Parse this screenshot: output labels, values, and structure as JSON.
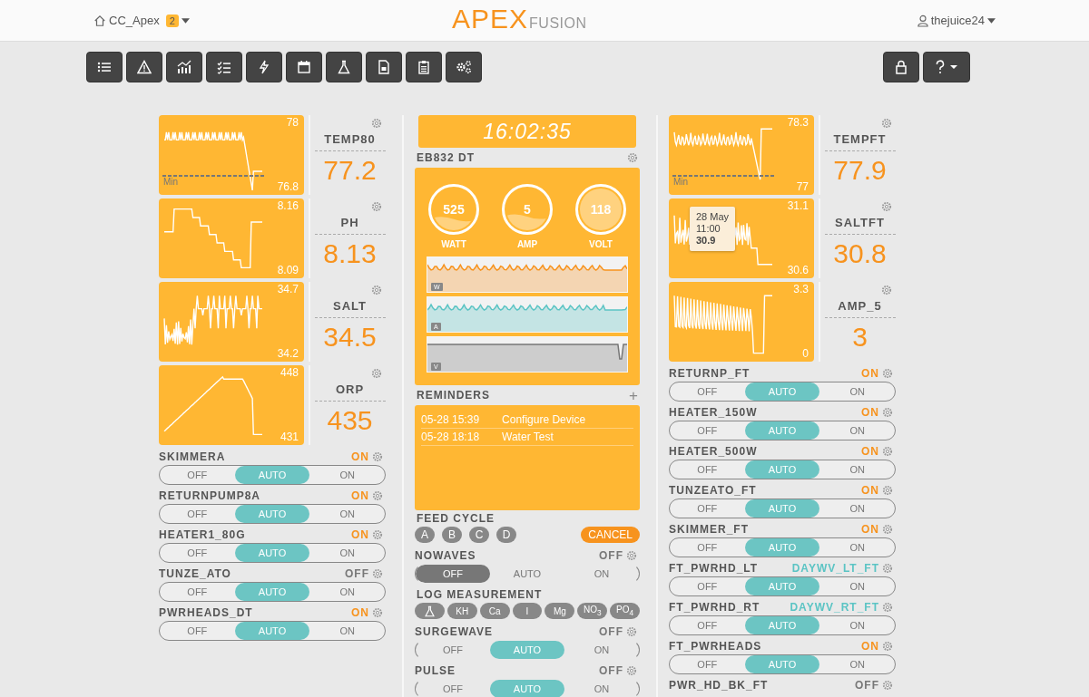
{
  "header": {
    "site": "CC_Apex",
    "badge": "2",
    "logo_main": "APEX",
    "logo_sub": "FUSION",
    "user": "thejuice24"
  },
  "left_sensors": [
    {
      "name": "TEMP80",
      "max": "78",
      "min": "76.8",
      "min_label": "Min",
      "value": "77.2"
    },
    {
      "name": "PH",
      "max": "8.16",
      "min": "8.09",
      "value": "8.13"
    },
    {
      "name": "SALT",
      "max": "34.7",
      "min": "34.2",
      "value": "34.5"
    },
    {
      "name": "ORP",
      "max": "448",
      "min": "431",
      "value": "435"
    }
  ],
  "left_outlets": [
    {
      "name": "SKIMMERA",
      "status": "ON",
      "color": "#f7931e",
      "options": [
        {
          "label": "OFF",
          "selected": false
        },
        {
          "label": "AUTO",
          "selected": true
        },
        {
          "label": "ON",
          "selected": false
        }
      ]
    },
    {
      "name": "RETURNPUMP8A",
      "status": "ON",
      "color": "#f7931e",
      "options": [
        {
          "label": "OFF",
          "selected": false
        },
        {
          "label": "AUTO",
          "selected": true
        },
        {
          "label": "ON",
          "selected": false
        }
      ]
    },
    {
      "name": "HEATER1_80G",
      "status": "ON",
      "color": "#f7931e",
      "options": [
        {
          "label": "OFF",
          "selected": false
        },
        {
          "label": "AUTO",
          "selected": true
        },
        {
          "label": "ON",
          "selected": false
        }
      ]
    },
    {
      "name": "TUNZE_ATO",
      "status": "OFF",
      "color": "#777777",
      "options": [
        {
          "label": "OFF",
          "selected": false
        },
        {
          "label": "AUTO",
          "selected": true
        },
        {
          "label": "ON",
          "selected": false
        }
      ]
    },
    {
      "name": "PWRHEADS_DT",
      "status": "ON",
      "color": "#f7931e",
      "options": [
        {
          "label": "OFF",
          "selected": false
        },
        {
          "label": "AUTO",
          "selected": true
        },
        {
          "label": "ON",
          "selected": false
        }
      ]
    }
  ],
  "clock": "16:02:35",
  "power": {
    "title": "EB832 DT",
    "gauges": [
      {
        "value": "525",
        "label": "WATT"
      },
      {
        "value": "5",
        "label": "AMP"
      },
      {
        "value": "118",
        "label": "VOLT"
      }
    ],
    "traces": [
      {
        "label": "W",
        "color": "#f7931e"
      },
      {
        "label": "A",
        "color": "#5bc4c4"
      },
      {
        "label": "V",
        "color": "#777777"
      }
    ]
  },
  "reminders": {
    "title": "REMINDERS",
    "add": "+",
    "items": [
      {
        "time": "05-28 15:39",
        "text": "Configure Device"
      },
      {
        "time": "05-28 18:18",
        "text": "Water Test"
      }
    ]
  },
  "feed_cycle": {
    "title": "FEED CYCLE",
    "buttons": [
      "A",
      "B",
      "C",
      "D"
    ],
    "cancel": "CANCEL"
  },
  "programs_top": [
    {
      "name": "NOWAVES",
      "status": "OFF",
      "options": [
        {
          "label": "OFF",
          "selected": true
        },
        {
          "label": "AUTO",
          "selected": false
        },
        {
          "label": "ON",
          "selected": false
        }
      ]
    }
  ],
  "log_measurement": {
    "title": "LOG MEASUREMENT",
    "buttons": [
      "KH",
      "Ca",
      "I",
      "Mg",
      "NO$_{3}$",
      "PO$_{4}$"
    ]
  },
  "programs_bottom": [
    {
      "name": "SURGEWAVE",
      "status": "OFF",
      "options": [
        {
          "label": "OFF",
          "selected": false
        },
        {
          "label": "AUTO",
          "selected": true
        },
        {
          "label": "ON",
          "selected": false
        }
      ]
    },
    {
      "name": "PULSE",
      "status": "OFF",
      "options": [
        {
          "label": "OFF",
          "selected": false
        },
        {
          "label": "AUTO",
          "selected": true
        },
        {
          "label": "ON",
          "selected": false
        }
      ]
    }
  ],
  "right_sensors": [
    {
      "name": "TEMPFT",
      "max": "78.3",
      "min": "77",
      "min_label": "Min",
      "value": "77.9"
    },
    {
      "name": "SALTFT",
      "max": "31.1",
      "min": "30.6",
      "value": "30.8",
      "tooltip": {
        "date": "28 May",
        "time": "11:00",
        "value": "30.9"
      }
    },
    {
      "name": "AMP_5",
      "max": "3.3",
      "min": "0",
      "value": "3"
    }
  ],
  "right_outlets": [
    {
      "name": "RETURNP_FT",
      "status": "ON",
      "color": "#f7931e",
      "options": [
        {
          "label": "OFF",
          "selected": false
        },
        {
          "label": "AUTO",
          "selected": true
        },
        {
          "label": "ON",
          "selected": false
        }
      ]
    },
    {
      "name": "HEATER_150W",
      "status": "ON",
      "color": "#f7931e",
      "options": [
        {
          "label": "OFF",
          "selected": false
        },
        {
          "label": "AUTO",
          "selected": true
        },
        {
          "label": "ON",
          "selected": false
        }
      ]
    },
    {
      "name": "HEATER_500W",
      "status": "ON",
      "color": "#f7931e",
      "options": [
        {
          "label": "OFF",
          "selected": false
        },
        {
          "label": "AUTO",
          "selected": true
        },
        {
          "label": "ON",
          "selected": false
        }
      ]
    },
    {
      "name": "TUNZEATO_FT",
      "status": "ON",
      "color": "#f7931e",
      "options": [
        {
          "label": "OFF",
          "selected": false
        },
        {
          "label": "AUTO",
          "selected": true
        },
        {
          "label": "ON",
          "selected": false
        }
      ]
    },
    {
      "name": "SKIMMER_FT",
      "status": "ON",
      "color": "#f7931e",
      "options": [
        {
          "label": "OFF",
          "selected": false
        },
        {
          "label": "AUTO",
          "selected": true
        },
        {
          "label": "ON",
          "selected": false
        }
      ]
    },
    {
      "name": "FT_PWRHD_LT",
      "status": "DAYWV_LT_FT",
      "color": "#5bc4c4",
      "options": [
        {
          "label": "OFF",
          "selected": false
        },
        {
          "label": "AUTO",
          "selected": true
        },
        {
          "label": "ON",
          "selected": false
        }
      ]
    },
    {
      "name": "FT_PWRHD_RT",
      "status": "DAYWV_RT_FT",
      "color": "#5bc4c4",
      "options": [
        {
          "label": "OFF",
          "selected": false
        },
        {
          "label": "AUTO",
          "selected": true
        },
        {
          "label": "ON",
          "selected": false
        }
      ]
    },
    {
      "name": "FT_PWRHEADS",
      "status": "ON",
      "color": "#f7931e",
      "options": [
        {
          "label": "OFF",
          "selected": false
        },
        {
          "label": "AUTO",
          "selected": true
        },
        {
          "label": "ON",
          "selected": false
        }
      ]
    },
    {
      "name": "PWR_HD_BK_FT",
      "status": "OFF",
      "color": "#777777"
    }
  ]
}
